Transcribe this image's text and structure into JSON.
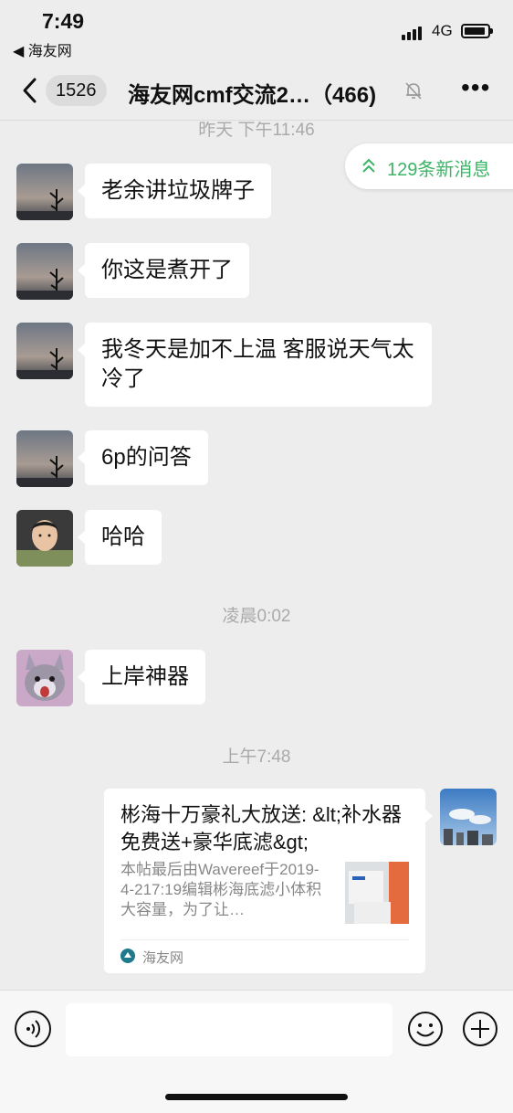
{
  "status_bar": {
    "time": "7:49",
    "back_app": "◀ 海友网",
    "network": "4G"
  },
  "nav": {
    "unread_count": "1526",
    "title": "海友网cmf交流2…（466)",
    "more_label": "•••"
  },
  "new_messages": {
    "label": "129条新消息",
    "color": "#3cb466"
  },
  "timestamps": {
    "t1": "昨天 下午11:46",
    "t2": "凌晨0:02",
    "t3": "上午7:48"
  },
  "messages": [
    {
      "sender": "user-a",
      "text": "老余讲垃圾牌子"
    },
    {
      "sender": "user-a",
      "text": "你这是煮开了"
    },
    {
      "sender": "user-a",
      "text": "我冬天是加不上温 客服说天气太冷了"
    },
    {
      "sender": "user-a",
      "text": "6p的问答"
    },
    {
      "sender": "user-b",
      "text": "哈哈"
    },
    {
      "sender": "user-c",
      "text": "上岸神器"
    }
  ],
  "link_card": {
    "title": "彬海十万豪礼大放送: &lt;补水器免费送+豪华底滤&gt;",
    "description": "本帖最后由Wavereef于2019-4-217:19编辑彬海底滤小体积大容量，为了让…",
    "source": "海友网"
  },
  "colors": {
    "background": "#ededed",
    "bubble": "#ffffff",
    "accent_green": "#3cb466"
  }
}
